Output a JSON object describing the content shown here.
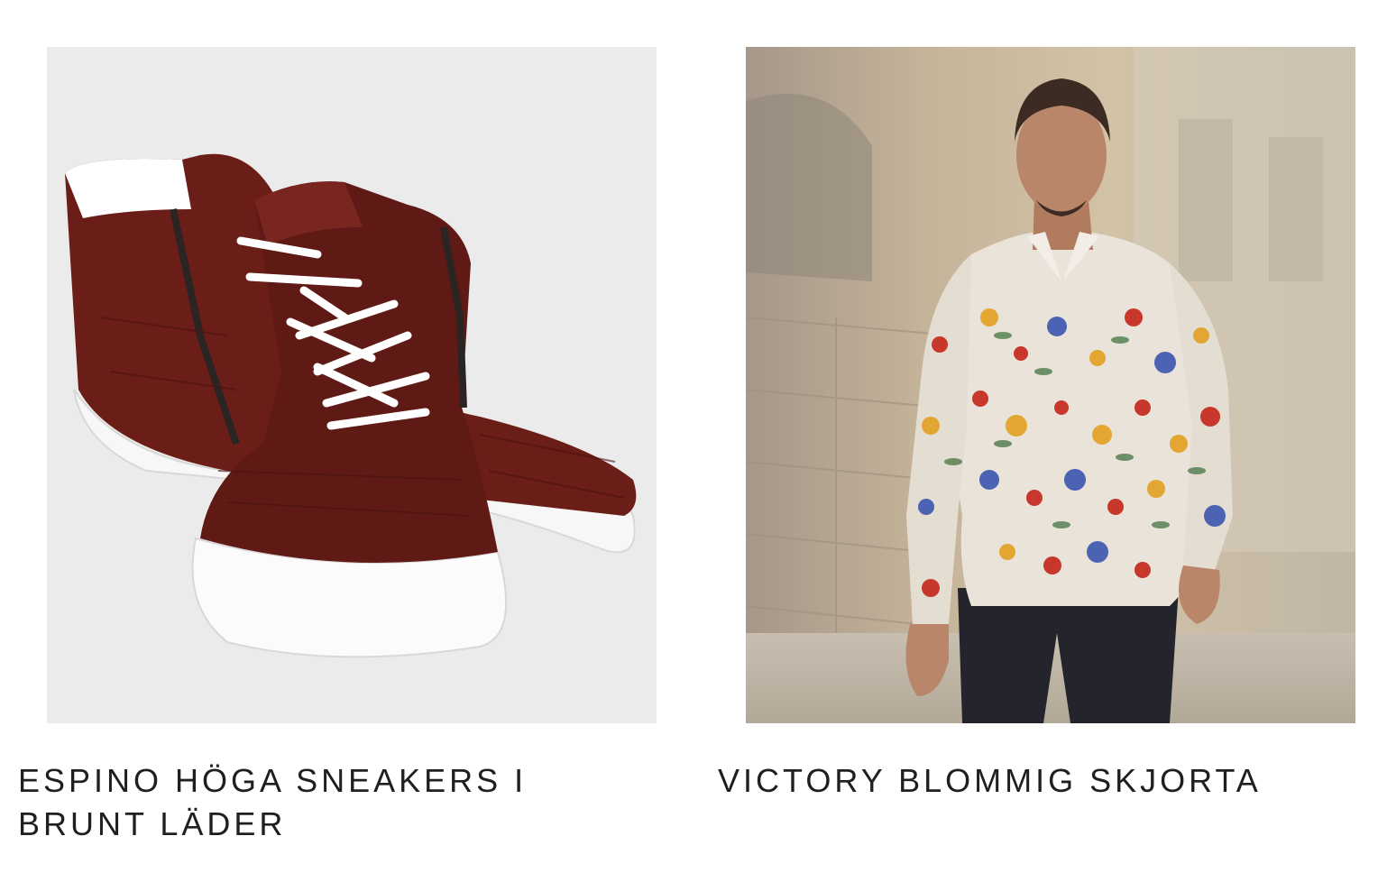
{
  "products": [
    {
      "title_line1": "ESPINO HÖGA SNEAKERS I",
      "title_line2": "BRUNT LÄDER",
      "image_alt": "Espino höga sneakers i brunt läder"
    },
    {
      "title_line1": "VICTORY BLOMMIG SKJORTA",
      "title_line2": "",
      "image_alt": "Victory blommig skjorta"
    }
  ]
}
